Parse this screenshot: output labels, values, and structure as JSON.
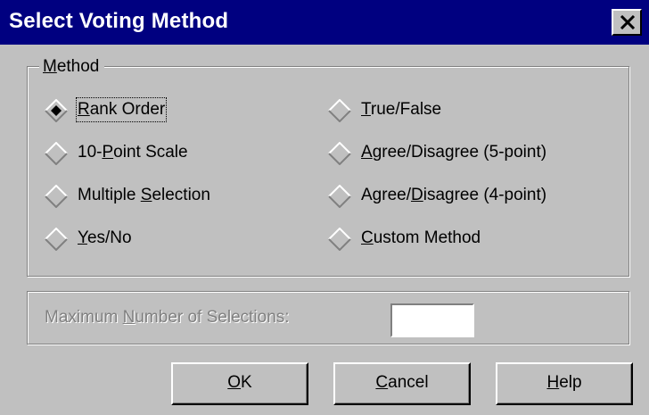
{
  "dialog": {
    "title": "Select Voting Method",
    "close_glyph": "×"
  },
  "method_group": {
    "legend": "Method",
    "selected": "Rank Order",
    "options": [
      {
        "label": "Rank Order",
        "checked": true,
        "focused": true
      },
      {
        "label": "10-Point Scale",
        "checked": false,
        "focused": false
      },
      {
        "label": "Multiple Selection",
        "checked": false,
        "focused": false
      },
      {
        "label": "Yes/No",
        "checked": false,
        "focused": false
      },
      {
        "label": "True/False",
        "checked": false,
        "focused": false
      },
      {
        "label": "Agree/Disagree (5-point)",
        "checked": false,
        "focused": false
      },
      {
        "label": "Agree/Disagree (4-point)",
        "checked": false,
        "focused": false
      },
      {
        "label": "Custom Method",
        "checked": false,
        "focused": false
      }
    ]
  },
  "max_selections": {
    "label": "Maximum Number of Selections:",
    "value": "",
    "disabled": true
  },
  "buttons": {
    "ok": "OK",
    "cancel": "Cancel",
    "help": "Help"
  },
  "colors": {
    "title_bar": "#000080",
    "face": "#c0c0c0",
    "shadow": "#808080",
    "highlight": "#ffffff"
  },
  "icons": {
    "radio": "diamond-radio-icon",
    "close": "close-icon"
  }
}
